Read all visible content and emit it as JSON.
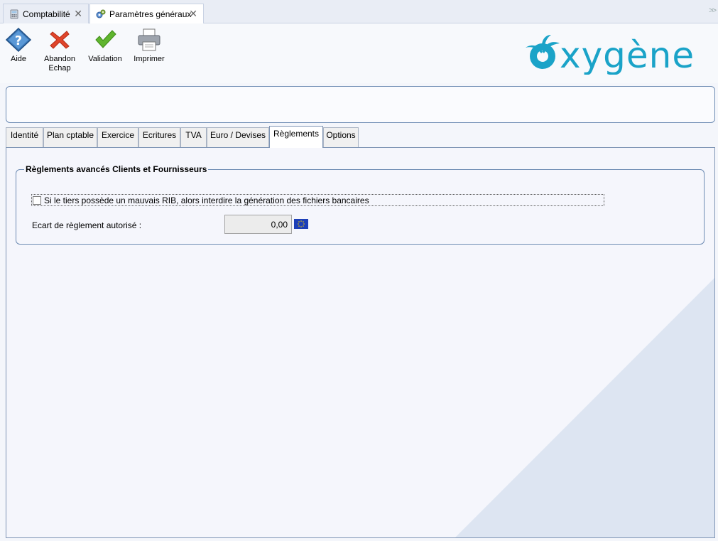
{
  "doc_tabs": [
    {
      "label": "Comptabilité",
      "active": false
    },
    {
      "label": "Paramètres généraux",
      "active": true
    }
  ],
  "toolbar": {
    "aide": "Aide",
    "abandon_line1": "Abandon",
    "abandon_line2": "Echap",
    "validation": "Validation",
    "imprimer": "Imprimer"
  },
  "logo_text": "oxygène",
  "page_tabs": [
    {
      "label": "Identité",
      "active": false
    },
    {
      "label": "Plan cptable",
      "active": false
    },
    {
      "label": "Exercice",
      "active": false
    },
    {
      "label": "Ecritures",
      "active": false
    },
    {
      "label": "TVA",
      "active": false
    },
    {
      "label": "Euro / Devises",
      "active": false
    },
    {
      "label": "Règlements",
      "active": true
    },
    {
      "label": "Options",
      "active": false
    }
  ],
  "group": {
    "title": "Règlements avancés Clients et Fournisseurs",
    "checkbox_label": "Si le tiers possède un mauvais RIB, alors interdire la génération des fichiers bancaires",
    "checkbox_checked": false,
    "ecart_label": "Ecart de règlement autorisé :",
    "ecart_value": "0,00"
  },
  "colors": {
    "accent": "#1aa3c8",
    "border": "#6d8bb3",
    "abandon": "#e0452b",
    "validation": "#5fb52e"
  }
}
